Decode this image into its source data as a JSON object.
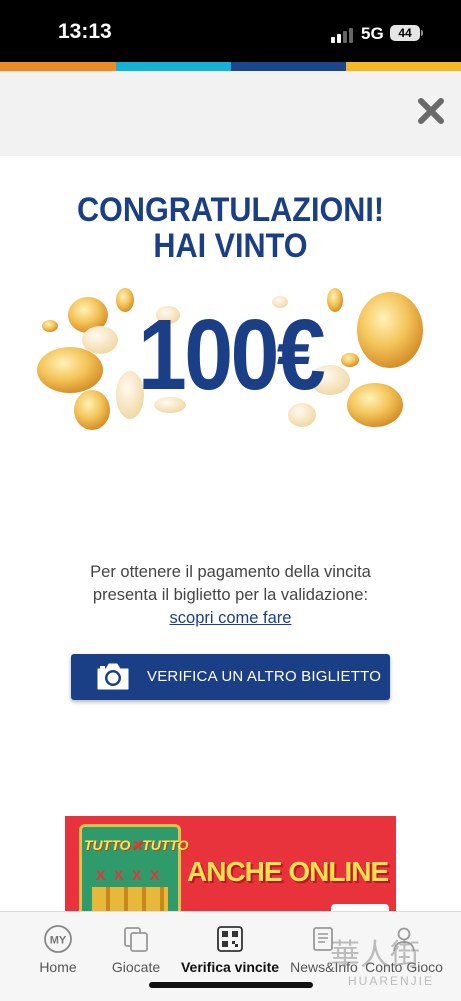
{
  "status_bar": {
    "time": "13:13",
    "network": "5G",
    "battery": "44"
  },
  "colors": {
    "brand_blue": "#1b3f87",
    "stripe_orange": "#f08a24",
    "stripe_cyan": "#16b1d8",
    "stripe_navy": "#1d4690",
    "stripe_yellow": "#f5b824",
    "banner_red": "#e8323c"
  },
  "dialog": {
    "close_icon": "close-x-icon",
    "heading_line1": "CONGRATULAZIONI!",
    "heading_line2": "HAI VINTO",
    "prize": "100€",
    "info_line1": "Per ottenere il pagamento della vincita",
    "info_line2": "presenta il biglietto per la validazione:",
    "info_link": "scopri come fare",
    "verify_button": "VERIFICA UN ALTRO BIGLIETTO",
    "verify_icon": "camera-icon"
  },
  "banner": {
    "ticket_title_1": "TUTTO",
    "ticket_title_2": "TUTTO",
    "ticket_mark": "X",
    "text": "ANCHE ONLINE"
  },
  "tab_bar": {
    "tabs": [
      {
        "label": "Home",
        "icon": "my-icon",
        "badge": "MY"
      },
      {
        "label": "Giocate",
        "icon": "tickets-icon"
      },
      {
        "label": "Verifica vincite",
        "icon": "qr-code-icon",
        "active": true
      },
      {
        "label": "News&Info",
        "icon": "news-icon"
      },
      {
        "label": "Conto Gioco",
        "icon": "user-icon"
      }
    ]
  },
  "watermark": {
    "cjk": "華人街",
    "latin": "HUARENJIE"
  }
}
